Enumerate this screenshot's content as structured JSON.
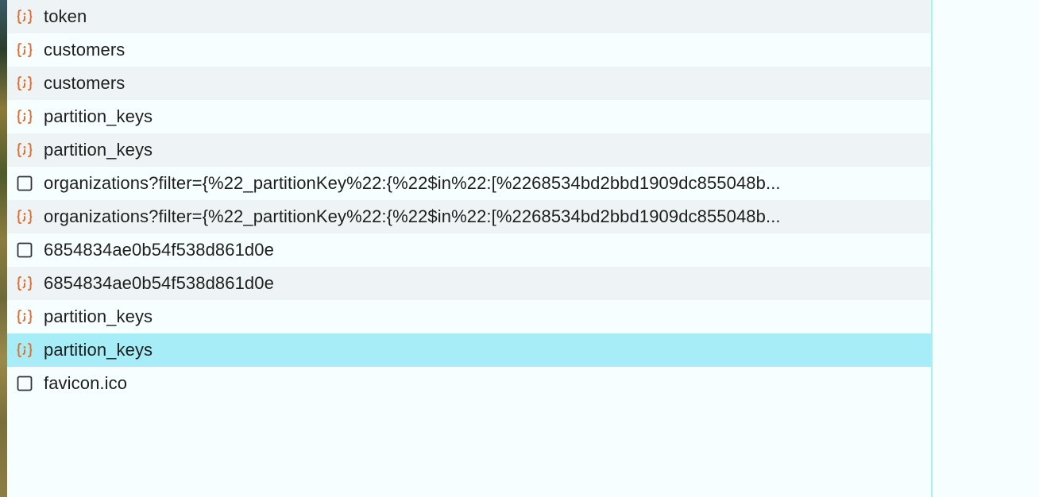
{
  "colors": {
    "accent_selected": "#a6edf7",
    "stripe": "#eef4f6",
    "background": "#f7feff",
    "fetch_icon": "#d9733a",
    "doc_icon": "#333333"
  },
  "requests": [
    {
      "name": "token",
      "icon": "json-braces-icon"
    },
    {
      "name": "customers",
      "icon": "json-braces-icon"
    },
    {
      "name": "customers",
      "icon": "json-braces-icon"
    },
    {
      "name": "partition_keys",
      "icon": "json-braces-icon"
    },
    {
      "name": "partition_keys",
      "icon": "json-braces-icon"
    },
    {
      "name": "organizations?filter={%22_partitionKey%22:{%22$in%22:[%2268534bd2bbd1909dc855048b...",
      "icon": "document-icon"
    },
    {
      "name": "organizations?filter={%22_partitionKey%22:{%22$in%22:[%2268534bd2bbd1909dc855048b...",
      "icon": "json-braces-icon"
    },
    {
      "name": "6854834ae0b54f538d861d0e",
      "icon": "document-icon"
    },
    {
      "name": "6854834ae0b54f538d861d0e",
      "icon": "json-braces-icon"
    },
    {
      "name": "partition_keys",
      "icon": "json-braces-icon"
    },
    {
      "name": "partition_keys",
      "icon": "json-braces-icon",
      "selected": true
    },
    {
      "name": "favicon.ico",
      "icon": "document-icon"
    }
  ]
}
